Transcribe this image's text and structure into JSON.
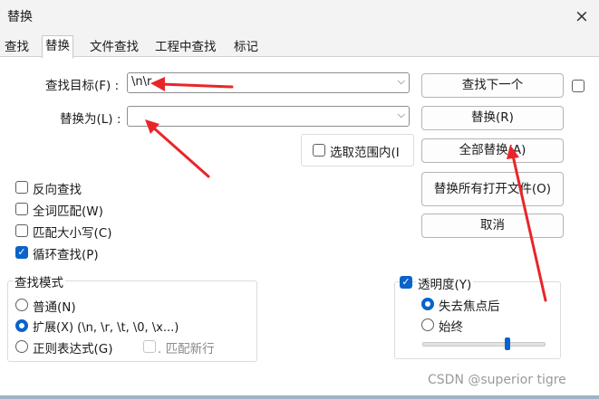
{
  "window": {
    "title": "替换",
    "close_symbol": "×"
  },
  "tabs": [
    {
      "label": "查找",
      "active": false
    },
    {
      "label": "替换",
      "active": true
    },
    {
      "label": "文件查找",
      "active": false
    },
    {
      "label": "工程中查找",
      "active": false
    },
    {
      "label": "标记",
      "active": false
    }
  ],
  "find": {
    "label": "查找目标(F) :",
    "value": "\\n\\r"
  },
  "replace": {
    "label": "替换为(L) :",
    "value": ""
  },
  "buttons": {
    "find_next": "查找下一个",
    "replace": "替换(R)",
    "replace_all": "全部替换(A)",
    "replace_all_open": "替换所有打开文件(O)",
    "cancel": "取消"
  },
  "in_selection": {
    "label": "选取范围内(I",
    "checked": false
  },
  "options": [
    {
      "label": "反向查找",
      "checked": false
    },
    {
      "label": "全词匹配(W)",
      "checked": false
    },
    {
      "label": "匹配大小写(C)",
      "checked": false
    },
    {
      "label": "循环查找(P)",
      "checked": true
    }
  ],
  "search_mode": {
    "title": "查找模式",
    "normal": "普通(N)",
    "extended": "扩展(X) (\\n, \\r, \\t, \\0, \\x...)",
    "regex": "正则表达式(G)",
    "match_newline": ". 匹配新行",
    "selected": "extended"
  },
  "transparency": {
    "label": "透明度(Y)",
    "checked": true,
    "on_lose_focus": "失去焦点后",
    "always": "始终",
    "selected": "on_lose_focus",
    "level": 0.7
  },
  "watermark": "CSDN @superior tigre",
  "colors": {
    "accent": "#0a63c9",
    "annotation_arrow": "#e8262a"
  }
}
